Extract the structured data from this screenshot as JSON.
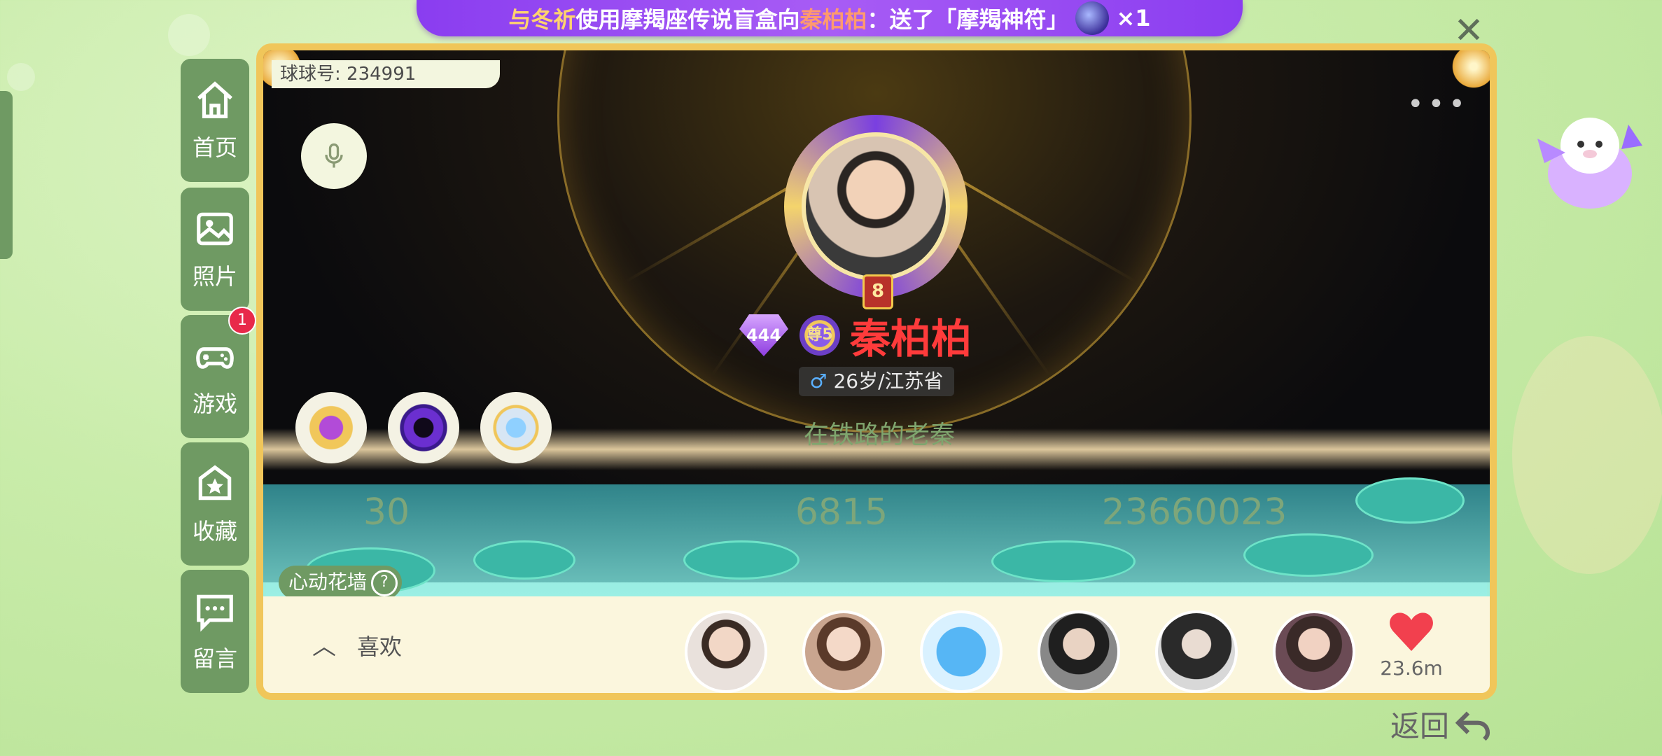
{
  "banner": {
    "sender": "与冬祈",
    "action": "使用摩羯座传说盲盒向",
    "receiver": "秦柏柏",
    "gift_prefix": "：送了「摩羯神符」",
    "gift_count": "×1",
    "gift_icon": "capricorn-talisman-icon"
  },
  "nav": {
    "items": [
      {
        "label": "首页",
        "icon": "home-icon"
      },
      {
        "label": "照片",
        "icon": "photo-icon"
      },
      {
        "label": "游戏",
        "icon": "gamepad-icon",
        "badge": "1"
      },
      {
        "label": "收藏",
        "icon": "star-house-icon"
      },
      {
        "label": "留言",
        "icon": "message-icon"
      }
    ]
  },
  "profile": {
    "id_label": "球球号: 234991",
    "name": "秦柏柏",
    "gem_level": "444",
    "noble_tag": "尊5",
    "avatar_level": "8",
    "gender_symbol": "♂",
    "age_location": "26岁/江苏省",
    "signature": "在铁路的老秦",
    "name_color": "#ff3b3b"
  },
  "stats": {
    "values": [
      "30",
      "6815",
      "23660023"
    ]
  },
  "flower_wall": {
    "label": "心动花墙",
    "help": "?"
  },
  "likes": {
    "toggle_label": "喜欢",
    "heart_count": "23.6m"
  },
  "footer": {
    "return_label": "返回"
  },
  "colors": {
    "nav_bg": "#6f9a63",
    "card_border": "#f0c65a",
    "banner": "#a85cf5"
  }
}
